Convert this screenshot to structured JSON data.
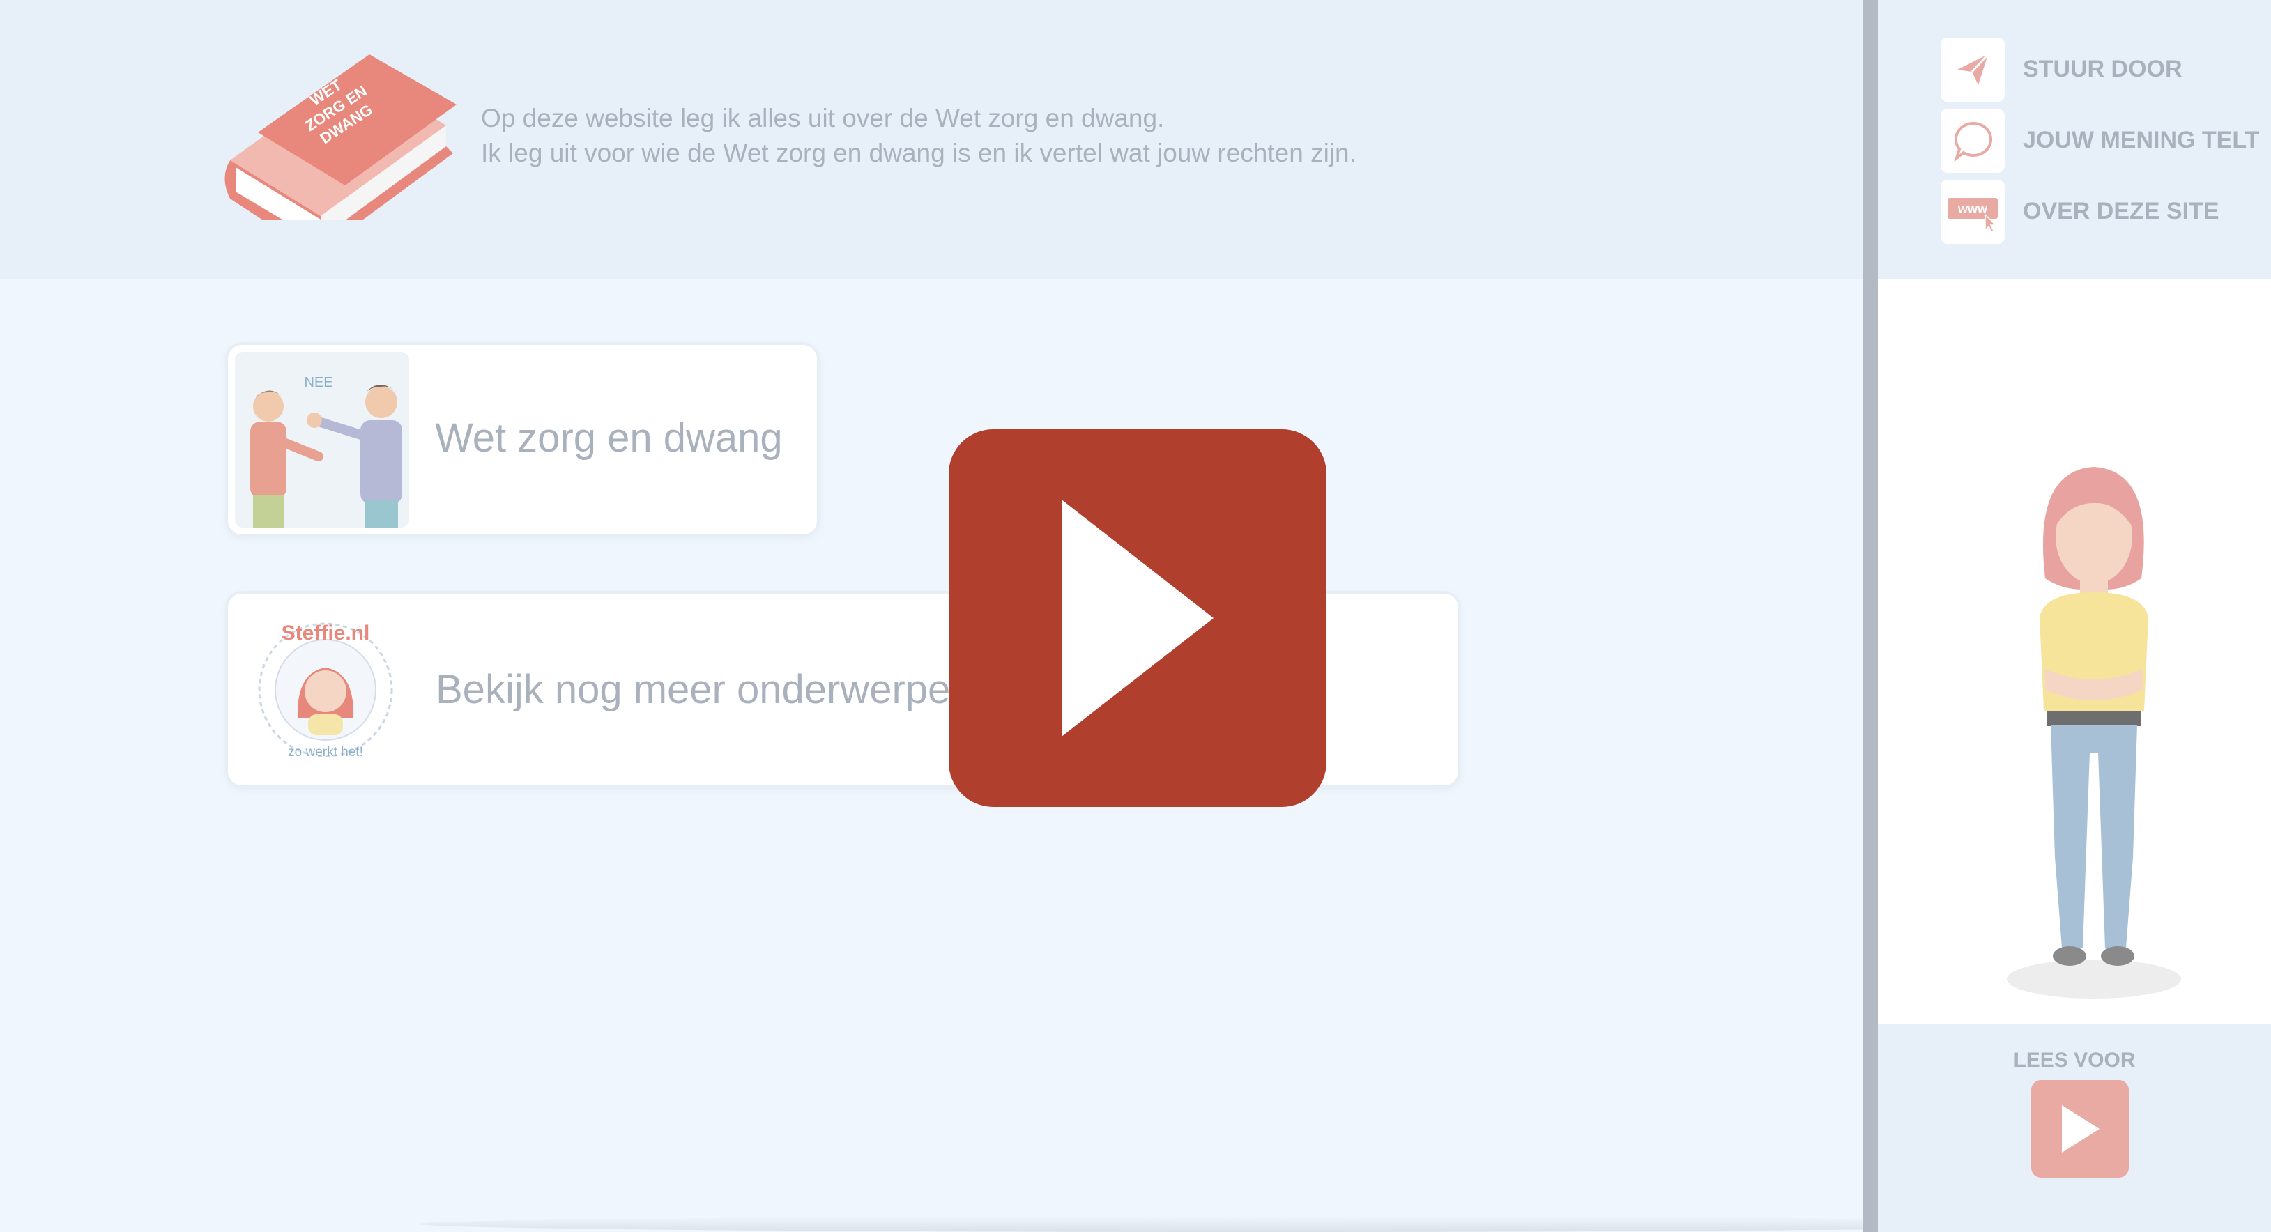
{
  "header": {
    "intro_line1": "Op deze website leg ik alles uit over de Wet zorg en dwang.",
    "intro_line2": "Ik leg uit voor wie de Wet zorg en dwang is en ik vertel wat jouw rechten zijn.",
    "book_icon": "book-icon",
    "book_text": [
      "WET",
      "ZORG EN",
      "DWANG"
    ]
  },
  "cards": [
    {
      "title": "Wet zorg en dwang",
      "speech": "NEE"
    },
    {
      "title": "Bekijk nog meer onderwerpen op",
      "logo_text_top": "Steffie.nl",
      "logo_text_bottom": "zo werkt het!"
    }
  ],
  "sidebar": {
    "menu": [
      {
        "label": "STUUR DOOR",
        "icon": "paper-plane-icon"
      },
      {
        "label": "JOUW MENING TELT",
        "icon": "speech-bubble-icon"
      },
      {
        "label": "OVER DEZE SITE",
        "icon": "www-cursor-icon",
        "icon_text": "www"
      }
    ],
    "lees_voor": "LEES VOOR"
  },
  "video": {
    "play_icon": "play-icon"
  },
  "colors": {
    "play_red": "#b03f2e",
    "accent_pink": "#e8aaa3",
    "text_grey": "#a9b1bd",
    "header_bg": "#e7f0f9",
    "page_bg": "#f0f6fd"
  }
}
